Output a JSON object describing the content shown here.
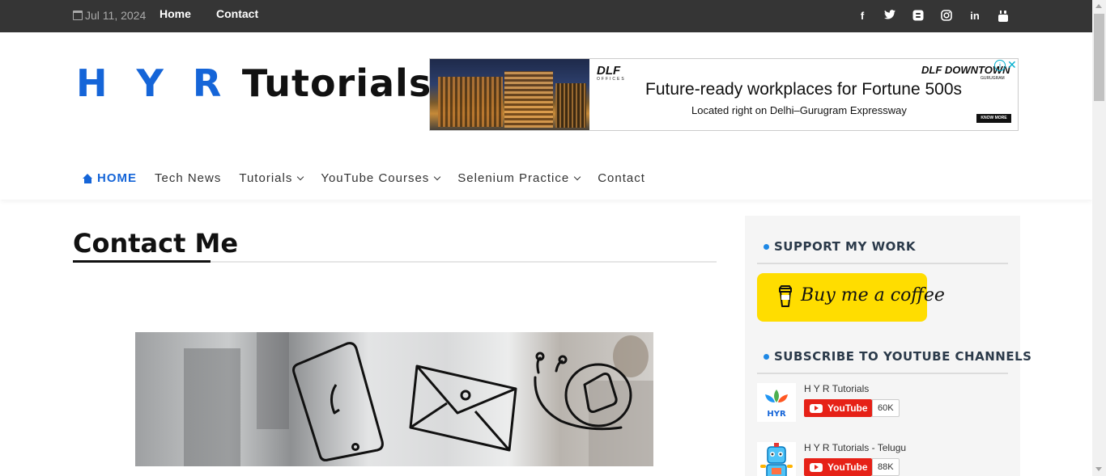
{
  "topbar": {
    "date": "Jul 11, 2024",
    "links": [
      "Home",
      "Contact"
    ],
    "social_icons": [
      "facebook-icon",
      "twitter-icon",
      "blogger-icon",
      "instagram-icon",
      "linkedin-icon",
      "youtube-icon"
    ]
  },
  "header": {
    "logo_hyr": "H Y R",
    "logo_tutorials": "Tutorials",
    "ad": {
      "brand": "DLF",
      "brand_sub": "OFFICES",
      "brand_right": "DLF DOWNTOWN",
      "brand_right_sub": "GURUGRAM",
      "headline": "Future-ready workplaces for Fortune 500s",
      "subline": "Located right on Delhi–Gurugram Expressway",
      "cta": "KNOW MORE"
    }
  },
  "nav": {
    "items": [
      {
        "label": "HOME",
        "active": true,
        "dropdown": false
      },
      {
        "label": "Tech News",
        "dropdown": false
      },
      {
        "label": "Tutorials",
        "dropdown": true
      },
      {
        "label": "YouTube Courses",
        "dropdown": true
      },
      {
        "label": "Selenium Practice",
        "dropdown": true
      },
      {
        "label": "Contact",
        "dropdown": false
      }
    ]
  },
  "main": {
    "title": "Contact Me"
  },
  "sidebar": {
    "support_title": "SUPPORT MY WORK",
    "coffee_label": "Buy me a coffee",
    "subscribe_title": "SUBSCRIBE TO YOUTUBE CHANNELS",
    "channels": [
      {
        "name": "H Y R Tutorials",
        "button": "YouTube",
        "count": "60K",
        "avatar_text": "HYR"
      },
      {
        "name": "H Y R Tutorials - Telugu",
        "button": "YouTube",
        "count": "88K"
      }
    ]
  },
  "colors": {
    "topbar_bg": "#353535",
    "accent_blue": "#1565d8",
    "coffee_yellow": "#ffdd00",
    "youtube_red": "#e62117",
    "sidebar_bg": "#f5f5f5"
  }
}
